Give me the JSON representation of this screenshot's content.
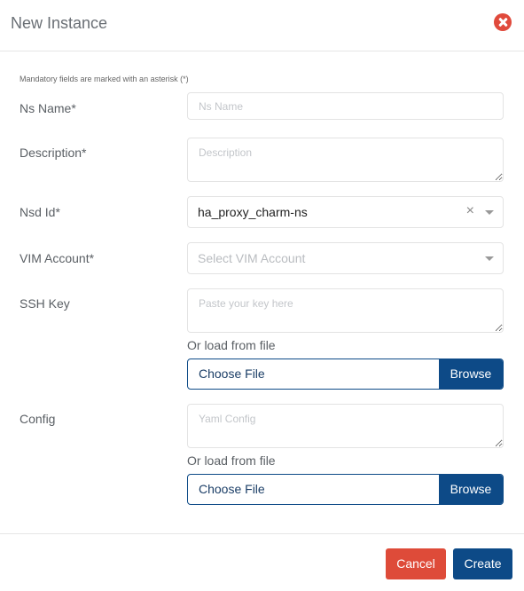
{
  "dialog": {
    "title": "New Instance",
    "close_icon": "close-circle-icon",
    "mandatory_note": "Mandatory fields are marked with an asterisk (*)"
  },
  "form": {
    "ns_name": {
      "label": "Ns Name*",
      "value": "",
      "placeholder": "Ns Name"
    },
    "description": {
      "label": "Description*",
      "value": "",
      "placeholder": "Description"
    },
    "nsd_id": {
      "label": "Nsd Id*",
      "value": "ha_proxy_charm-ns",
      "clear_glyph": "×"
    },
    "vim_account": {
      "label": "VIM Account*",
      "placeholder": "Select VIM Account"
    },
    "ssh_key": {
      "label": "SSH Key",
      "value": "",
      "placeholder": "Paste your key here",
      "or_load": "Or load from file",
      "file_text": "Choose File",
      "browse_label": "Browse"
    },
    "config": {
      "label": "Config",
      "value": "",
      "placeholder": "Yaml Config",
      "or_load": "Or load from file",
      "file_text": "Choose File",
      "browse_label": "Browse"
    }
  },
  "footer": {
    "cancel_label": "Cancel",
    "create_label": "Create"
  },
  "colors": {
    "primary": "#0d4a87",
    "danger": "#de4b39"
  }
}
